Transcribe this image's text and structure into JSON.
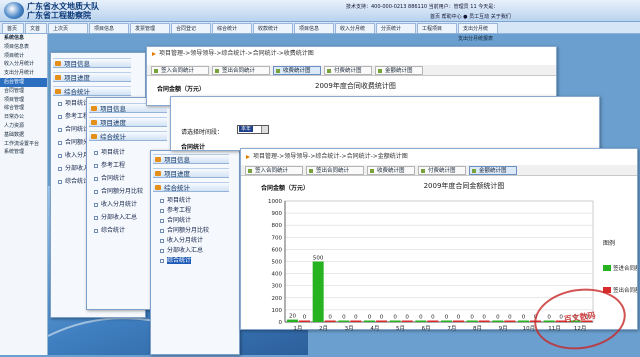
{
  "header": {
    "org_line1": "广东省水文地质大队",
    "org_line2": "广东省工程勘察院",
    "info": "技术支持：400-000-0213  886110  当前用户：管理员  11  今天是：",
    "links": "首页  帮助中心  ●  员工互动  关于我们"
  },
  "tabs": [
    "首页",
    "文首",
    "上次页",
    "项目信息",
    "发票管理",
    "合同登记",
    "综合统计",
    "收款统计",
    "项目信息",
    "收入分月统",
    "分页统计",
    "工程项目",
    "支出分月统"
  ],
  "sidebar": {
    "title": "系统信息",
    "items": [
      "项目信息表",
      "项目统计",
      "收入分月统计",
      "支出分月统计",
      "后台管理",
      "合同管理",
      "项目管理",
      "综合管理",
      "日常办公",
      "人力资源",
      "基础数据",
      "工作流设置平台",
      "系统管理"
    ],
    "active_index": 4
  },
  "section_label": "支出分月统报表",
  "win1": {
    "menu": [
      "项目信息",
      "项目进度",
      "综合统计"
    ],
    "subs": [
      "项目统计",
      "参考工程",
      "合同统计",
      "合同额分月比较",
      "收入分月统计",
      "分部收入汇总",
      "综合统计"
    ]
  },
  "win2": {
    "menu": [
      "项目信息",
      "项目进度",
      "综合统计"
    ],
    "subs": [
      "项目统计",
      "参考工程",
      "合同统计",
      "合同额分月比较",
      "收入分月统计",
      "分部收入汇总",
      "综合统计"
    ]
  },
  "win3": {
    "menu": [
      "项目信息",
      "项目进度",
      "综合统计"
    ],
    "subs": [
      "项目统计",
      "参考工程",
      "合同统计",
      "合同额分月比较",
      "收入分月统计",
      "分部收入汇总",
      "综合统计"
    ],
    "highlight_index": 6
  },
  "panelA": {
    "crumb": "项目管理->领导领导->综合统计->合同统计->收费统计图",
    "buttons": [
      "签入合同统计",
      "签出合同统计",
      "收费统计图",
      "付费统计图",
      "金额统计图"
    ],
    "active_button": 2,
    "unit": "合同金额（万元）",
    "chart_title": "2009年度合同收费统计图"
  },
  "panelB": {
    "period_label": "请选择时间段：",
    "period_value": "本年",
    "section": "合同统计"
  },
  "panelC": {
    "crumb": "项目管理->领导领导->综合统计->合同统计->金额统计图",
    "buttons": [
      "签入合同统计",
      "签出合同统计",
      "收费统计图",
      "付费统计图",
      "金额统计图"
    ],
    "active_button": 4,
    "unit": "合同金额（万元）",
    "legend_title": "图例",
    "legend": [
      "签进合同额",
      "签出合同额"
    ]
  },
  "stamp_text": "百文数码",
  "colors": {
    "green": "#27b21f",
    "red": "#d82a2a",
    "accent": "#2c6fc0"
  },
  "chart_data": {
    "type": "bar",
    "title": "2009年度合同金额统计图",
    "ylabel": "合同金额（万元）",
    "categories": [
      "1月",
      "2月",
      "3月",
      "4月",
      "5月",
      "6月",
      "7月",
      "8月",
      "9月",
      "10月",
      "11月",
      "12月"
    ],
    "series": [
      {
        "name": "签进合同额",
        "color": "#27b21f",
        "values": [
          20,
          500,
          0,
          0,
          0,
          0,
          0,
          0,
          0,
          0,
          0,
          0
        ]
      },
      {
        "name": "签出合同额",
        "color": "#d82a2a",
        "values": [
          0,
          0,
          0,
          0,
          0,
          0,
          0,
          0,
          0,
          0,
          0,
          0
        ]
      }
    ],
    "ylim": [
      0,
      1000
    ],
    "yticks": [
      0,
      100,
      200,
      300,
      400,
      500,
      600,
      700,
      800,
      900,
      1000
    ],
    "grid": true,
    "legend": "right"
  }
}
